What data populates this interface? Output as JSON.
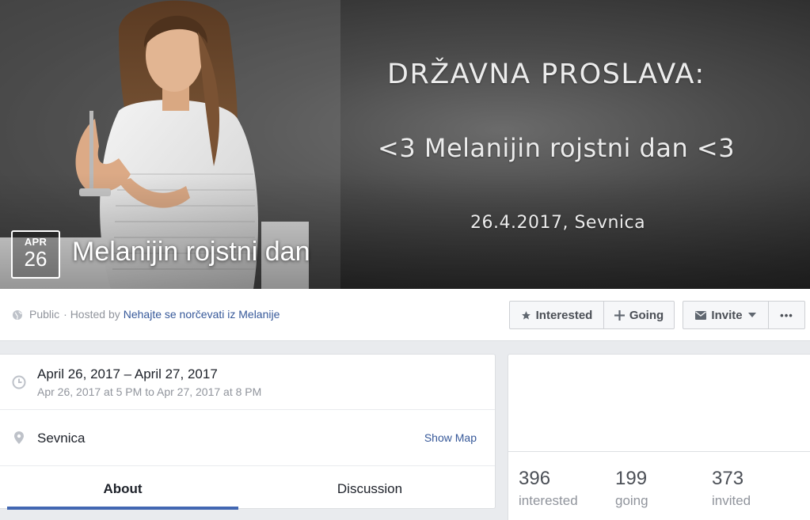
{
  "cover": {
    "line1": "DRŽAVNA PROSLAVA:",
    "line2": "<3 Melanijin rojstni dan <3",
    "line3": "26.4.2017, Sevnica"
  },
  "event": {
    "month": "APR",
    "day": "26",
    "title": "Melanijin rojstni dan"
  },
  "meta": {
    "visibility": "Public",
    "hosted_by_prefix": "· Hosted by",
    "host": "Nehajte se norčevati iz Melanije"
  },
  "actions": {
    "interested": "Interested",
    "going": "Going",
    "invite": "Invite",
    "more": "•••"
  },
  "details": {
    "date_range": "April 26, 2017 – April 27, 2017",
    "date_detail": "Apr 26, 2017 at 5 PM to Apr 27, 2017 at 8 PM",
    "location": "Sevnica",
    "show_map": "Show Map"
  },
  "tabs": [
    {
      "label": "About",
      "active": true
    },
    {
      "label": "Discussion",
      "active": false
    }
  ],
  "stats": [
    {
      "count": "396",
      "label": "interested"
    },
    {
      "count": "199",
      "label": "going"
    },
    {
      "count": "373",
      "label": "invited"
    }
  ],
  "colors": {
    "link": "#365899",
    "tab_active": "#4267b2",
    "muted": "#90949c",
    "background": "#e9ebee"
  },
  "icons": [
    "globe-icon",
    "star-icon",
    "plus-icon",
    "envelope-icon",
    "chevron-down-icon",
    "clock-icon",
    "map-pin-icon"
  ]
}
